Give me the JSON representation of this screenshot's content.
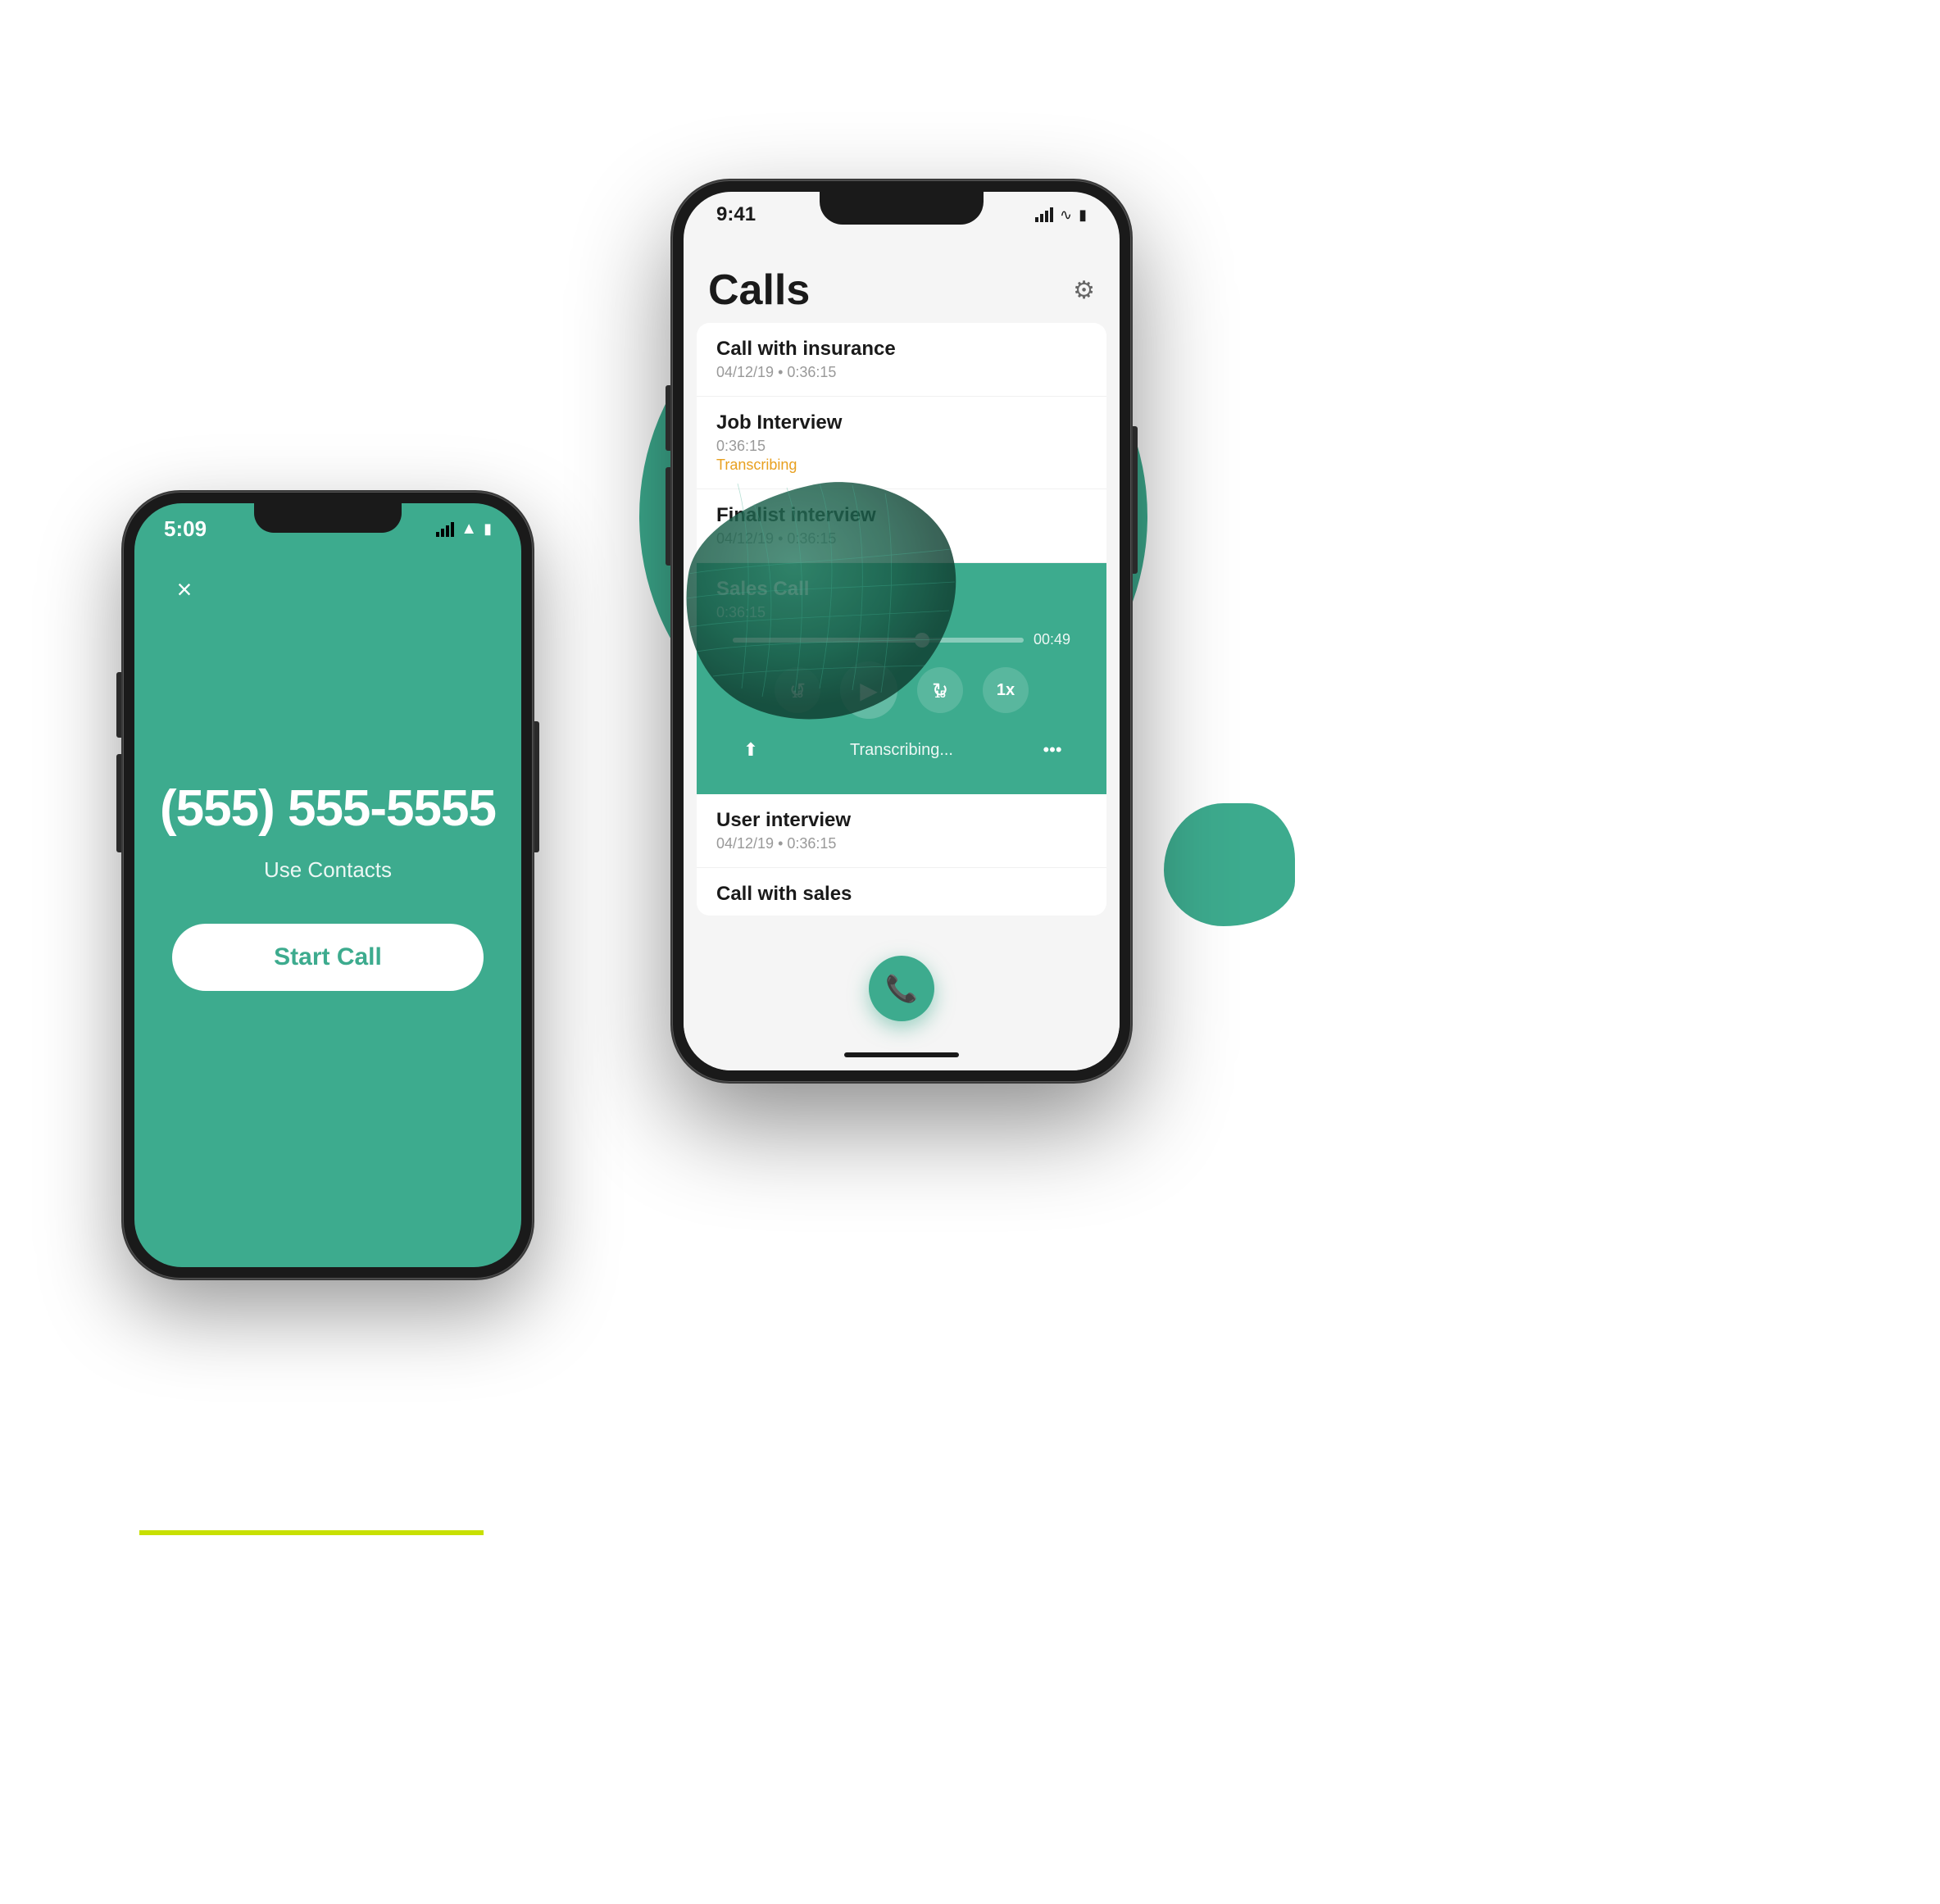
{
  "background": {
    "circle_color": "#3dab8e",
    "blob_dark_color": "#1a5c4a",
    "blob_small_color": "#3dab8e",
    "lime_color": "#c8e000"
  },
  "left_phone": {
    "time": "5:09",
    "close_icon": "×",
    "phone_number": "(555) 555-5555",
    "use_contacts": "Use Contacts",
    "start_call_button": "Start Call"
  },
  "right_phone": {
    "time": "9:41",
    "gear_icon": "⚙",
    "title": "Calls",
    "calls": [
      {
        "name": "Call with insurance",
        "meta": "04/12/19  •  0:36:15",
        "status": ""
      },
      {
        "name": "Job Interview",
        "meta": "0:36:15",
        "status": "Transcribing",
        "status_color": "#e8a020"
      },
      {
        "name": "Finalist interview",
        "meta": "04/12/19  •  0:36:15",
        "status": ""
      },
      {
        "name": "Sales Call",
        "meta": "0:36:15",
        "status": "active",
        "active": true,
        "progress": "00:49",
        "speed": "1x",
        "transcribing": "Transcribing..."
      }
    ],
    "below_calls": [
      {
        "name": "User interview",
        "meta": "04/12/19  •  0:36:15"
      },
      {
        "name": "Call with sales",
        "meta": ""
      }
    ],
    "fab_icon": "📞"
  }
}
